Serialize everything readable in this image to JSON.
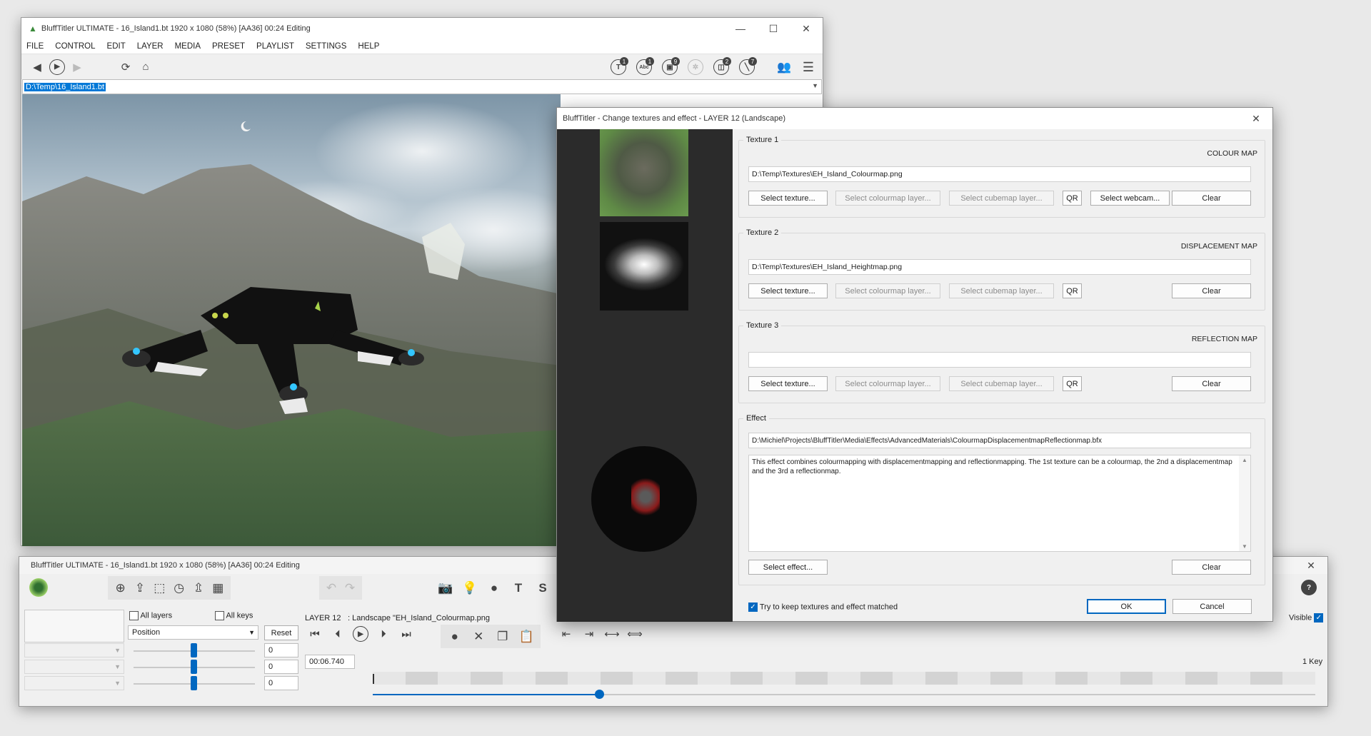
{
  "main_window": {
    "title": "BluffTitler ULTIMATE  - 16_Island1.bt 1920 x 1080 (58%) [AA36] 00:24 Editing",
    "menu": [
      "FILE",
      "CONTROL",
      "EDIT",
      "LAYER",
      "MEDIA",
      "PRESET",
      "PLAYLIST",
      "SETTINGS",
      "HELP"
    ],
    "path": "D:\\Temp\\16_Island1.bt",
    "badges": [
      "1",
      "1",
      "9",
      "2",
      "7"
    ],
    "layer_icons": [
      "T",
      "Abc",
      "img-icon",
      "particles-icon",
      "cube-icon",
      "tool-icon"
    ]
  },
  "timeline_window": {
    "title": "BluffTitler ULTIMATE  - 16_Island1.bt 1920 x 1080 (58%) [AA36] 00:24 Editing",
    "all_layers": "All layers",
    "all_keys": "All keys",
    "property": "Position",
    "reset": "Reset",
    "values": [
      "0",
      "0",
      "0"
    ],
    "layer_label": "LAYER 12",
    "layer_desc": ": Landscape \"EH_Island_Colourmap.png",
    "time": "00:06.740",
    "visible": "Visible",
    "keys": "1 Key",
    "position": 0.24
  },
  "dialog": {
    "title": "BluffTitler - Change textures and effect - LAYER 12 (Landscape)",
    "textures": [
      {
        "title": "Texture 1",
        "maptype": "COLOUR MAP",
        "path": "D:\\Temp\\Textures\\EH_Island_Colourmap.png",
        "has_webcam": true
      },
      {
        "title": "Texture 2",
        "maptype": "DISPLACEMENT MAP",
        "path": "D:\\Temp\\Textures\\EH_Island_Heightmap.png",
        "has_webcam": false
      },
      {
        "title": "Texture 3",
        "maptype": "REFLECTION MAP",
        "path": "",
        "has_webcam": false
      }
    ],
    "select_texture": "Select texture...",
    "select_colourmap": "Select colourmap layer...",
    "select_cubemap": "Select cubemap layer...",
    "qr": "QR",
    "select_webcam": "Select webcam...",
    "clear": "Clear",
    "effect_title": "Effect",
    "effect_path": "D:\\Michiel\\Projects\\BluffTitler\\Media\\Effects\\AdvancedMaterials\\ColourmapDisplacementmapReflectionmap.bfx",
    "effect_desc": "This effect combines colourmapping with displacementmapping and reflectionmapping. The 1st texture can be a colourmap, the 2nd a displacementmap and the 3rd a reflectionmap.",
    "select_effect": "Select effect...",
    "keep_matched": "Try to keep textures and effect matched",
    "ok": "OK",
    "cancel": "Cancel"
  }
}
